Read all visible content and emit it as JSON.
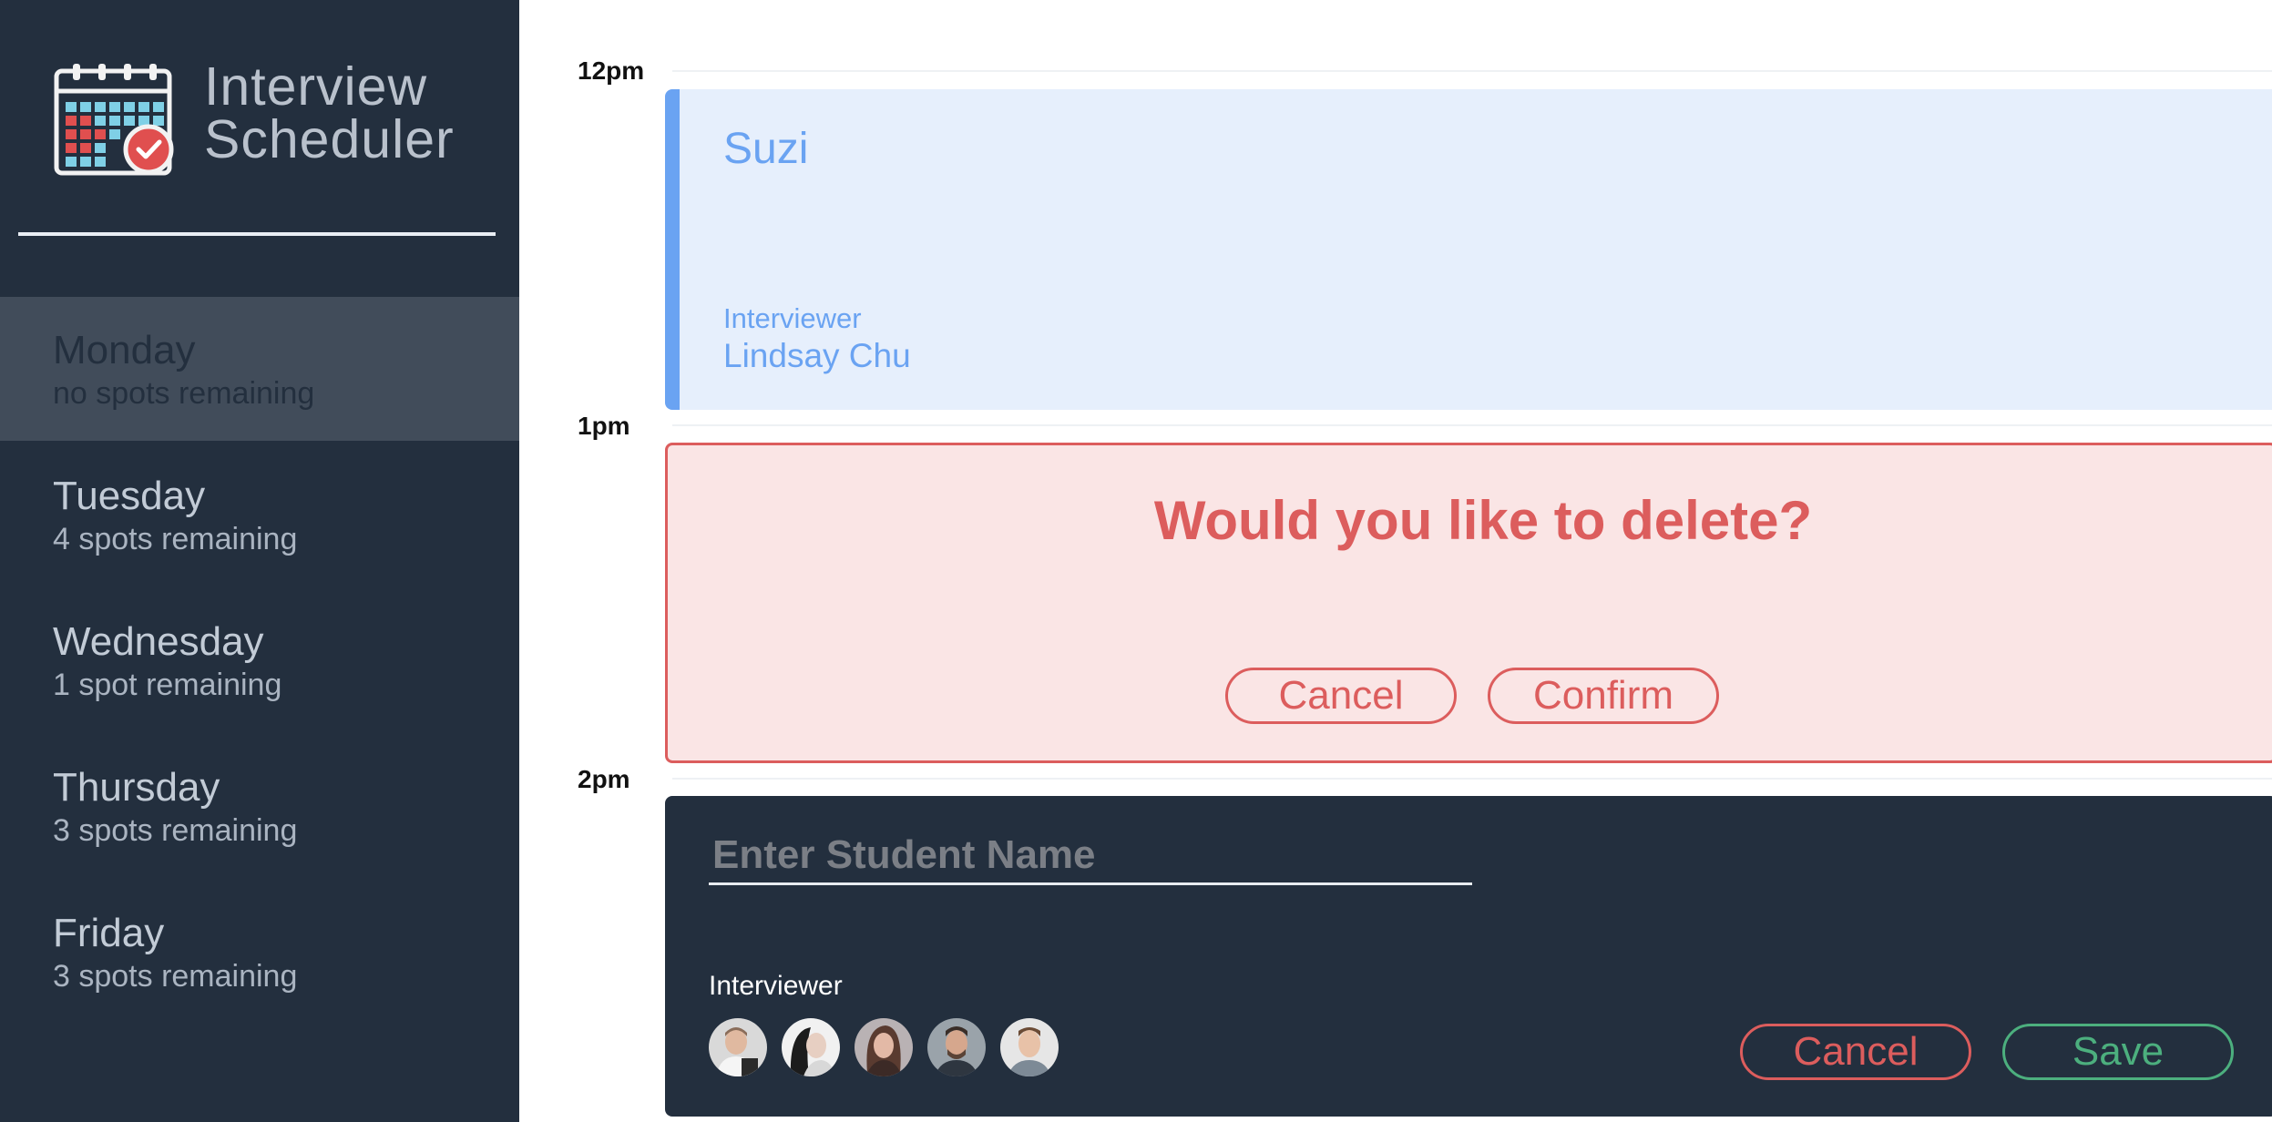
{
  "app": {
    "title_line1": "Interview",
    "title_line2": "Scheduler"
  },
  "sidebar": {
    "days": [
      {
        "name": "Monday",
        "spots": "no spots remaining",
        "selected": true
      },
      {
        "name": "Tuesday",
        "spots": "4 spots remaining",
        "selected": false
      },
      {
        "name": "Wednesday",
        "spots": "1 spot remaining",
        "selected": false
      },
      {
        "name": "Thursday",
        "spots": "3 spots remaining",
        "selected": false
      },
      {
        "name": "Friday",
        "spots": "3 spots remaining",
        "selected": false
      }
    ]
  },
  "schedule": {
    "times": [
      "12pm",
      "1pm",
      "2pm"
    ],
    "booked": {
      "student": "Suzi",
      "interviewer_label": "Interviewer",
      "interviewer_name": "Lindsay Chu"
    },
    "confirm": {
      "message": "Would you like to delete?",
      "cancel_label": "Cancel",
      "confirm_label": "Confirm"
    },
    "form": {
      "name_placeholder": "Enter Student Name",
      "name_value": "",
      "interviewer_label": "Interviewer",
      "interviewers": [
        "interviewer-avatar-1",
        "interviewer-avatar-2",
        "interviewer-avatar-3",
        "interviewer-avatar-4",
        "interviewer-avatar-5"
      ],
      "cancel_label": "Cancel",
      "save_label": "Save"
    }
  },
  "colors": {
    "sidebar": "#232f3e",
    "selected_day": "#414c5a",
    "accent_blue": "#6aa3f2",
    "danger": "#dc5d5d",
    "success": "#4caf7e"
  }
}
